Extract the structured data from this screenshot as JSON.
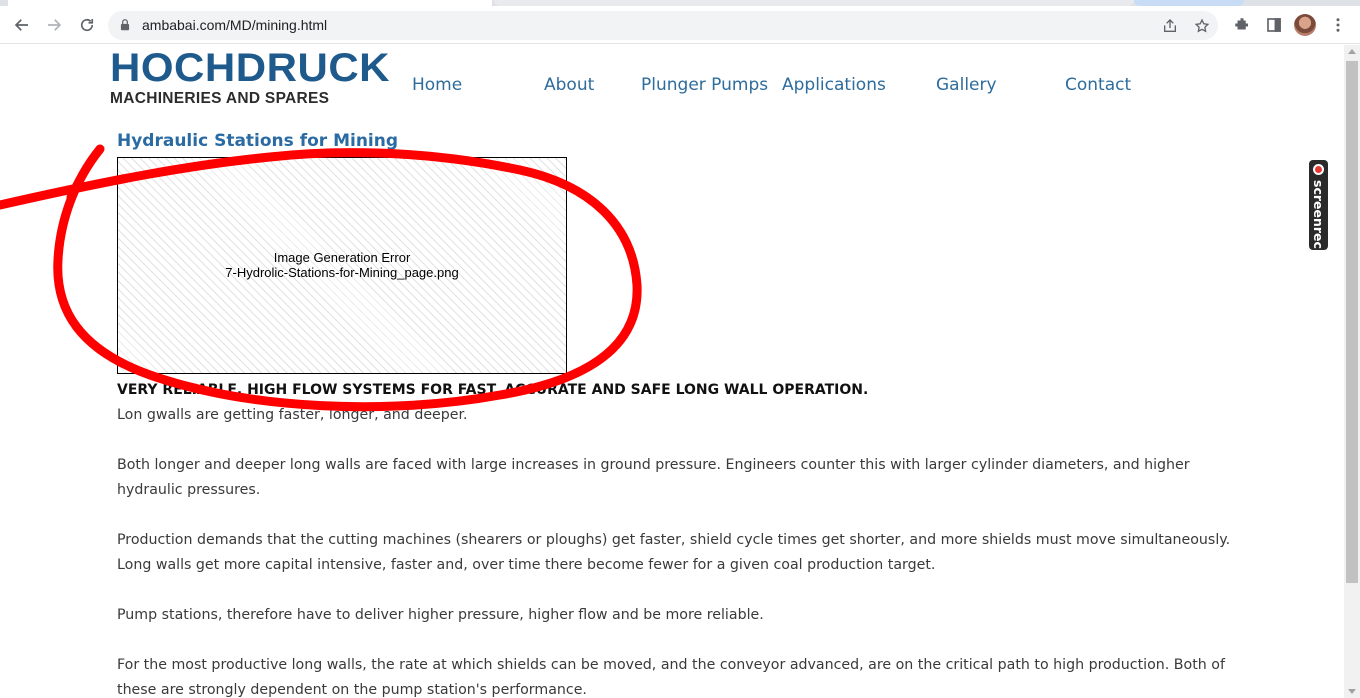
{
  "browser": {
    "url": "ambabai.com/MD/mining.html",
    "icons": [
      "back-arrow-icon",
      "forward-arrow-icon",
      "reload-icon",
      "lock-icon",
      "share-icon",
      "star-icon",
      "extensions-icon",
      "sidepanel-icon",
      "menu-kebab-icon"
    ]
  },
  "site": {
    "logo_brand": "HOCHDRUCK",
    "logo_sub": "MACHINERIES AND SPARES",
    "nav": [
      "Home",
      "About",
      "Plunger Pumps",
      "Applications",
      "Gallery",
      "Contact"
    ]
  },
  "main": {
    "title": "Hydraulic Stations for Mining",
    "image_error": {
      "line1": "Image Generation Error",
      "line2": "7-Hydrolic-Stations-for-Mining_page.png"
    },
    "lead": "VERY RELIABLE, HIGH FLOW SYSTEMS FOR FAST, ACCURATE AND SAFE LONG WALL OPERATION.",
    "paragraphs": [
      "Lon gwalls are getting faster, longer, and deeper.",
      "Both longer and deeper long walls are faced with large increases in ground pressure. Engineers counter this with larger cylinder diameters, and higher hydraulic pressures.",
      "Production demands that the cutting machines (shearers or ploughs) get faster, shield cycle times get shorter, and more shields must move simultaneously.",
      "Long walls get more capital intensive, faster and, over time there become fewer for a given coal production target.",
      "Pump stations, therefore have to deliver higher pressure, higher flow and be more reliable.",
      "For the most productive long walls, the rate at which shields can be moved, and the conveyor advanced, are on the critical path to high production. Both of these are strongly dependent on the pump station's performance."
    ]
  },
  "overlay": {
    "screenrec_label": "screenrec",
    "annotation_color": "#ff0000"
  },
  "colors": {
    "nav_link": "#2d6c9c",
    "title": "#2b6ba3",
    "logo_blue": "#1f5a8c"
  }
}
